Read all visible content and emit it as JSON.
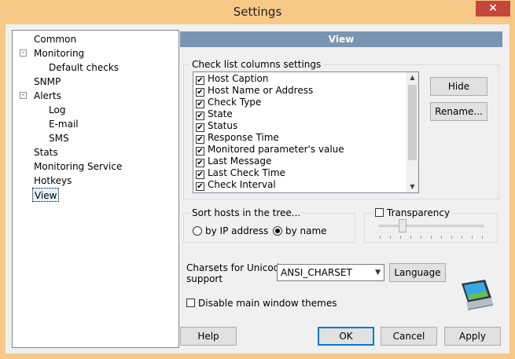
{
  "window": {
    "title": "Settings",
    "close_glyph": "×",
    "colors": {
      "frame": "#f6c987",
      "close": "#c7463a",
      "header": "#7a95b3"
    }
  },
  "tree": {
    "items": [
      {
        "label": "Common",
        "level": 0,
        "expander": ""
      },
      {
        "label": "Monitoring",
        "level": 0,
        "expander": "-"
      },
      {
        "label": "Default checks",
        "level": 1,
        "expander": ""
      },
      {
        "label": "SNMP",
        "level": 0,
        "expander": ""
      },
      {
        "label": "Alerts",
        "level": 0,
        "expander": "-"
      },
      {
        "label": "Log",
        "level": 1,
        "expander": ""
      },
      {
        "label": "E-mail",
        "level": 1,
        "expander": ""
      },
      {
        "label": "SMS",
        "level": 1,
        "expander": ""
      },
      {
        "label": "Stats",
        "level": 0,
        "expander": ""
      },
      {
        "label": "Monitoring Service",
        "level": 0,
        "expander": ""
      },
      {
        "label": "Hotkeys",
        "level": 0,
        "expander": ""
      },
      {
        "label": "View",
        "level": 0,
        "expander": "",
        "selected": true
      }
    ]
  },
  "view": {
    "header": "View",
    "columns_group": {
      "label": "Check list columns settings",
      "items": [
        {
          "label": "Host Caption",
          "checked": true
        },
        {
          "label": "Host Name or Address",
          "checked": true
        },
        {
          "label": "Check Type",
          "checked": true
        },
        {
          "label": "State",
          "checked": true
        },
        {
          "label": "Status",
          "checked": true
        },
        {
          "label": "Response Time",
          "checked": true
        },
        {
          "label": "Monitored parameter's value",
          "checked": true
        },
        {
          "label": "Last Message",
          "checked": true
        },
        {
          "label": "Last Check Time",
          "checked": true
        },
        {
          "label": "Check Interval",
          "checked": true
        }
      ],
      "hide_label": "Hide",
      "rename_label": "Rename..."
    },
    "sort_group": {
      "label": "Sort hosts in the tree...",
      "option_ip": "by IP address",
      "option_name": "by name",
      "selected": "by name"
    },
    "transparency": {
      "label": "Transparency",
      "checked": false,
      "level": 0.2
    },
    "charset": {
      "label_line1": "Charsets for Unicode",
      "label_line2": "support",
      "value": "ANSI_CHARSET",
      "language_label": "Language"
    },
    "disable_themes_label": "Disable main window themes",
    "disable_themes_checked": false
  },
  "footer": {
    "help_label": "Help",
    "ok_label": "OK",
    "cancel_label": "Cancel",
    "apply_label": "Apply"
  },
  "icons": {
    "check": "✔",
    "scroll_up": "▲",
    "scroll_down": "▼",
    "dropdown": "▼",
    "expander_minus": "-"
  }
}
